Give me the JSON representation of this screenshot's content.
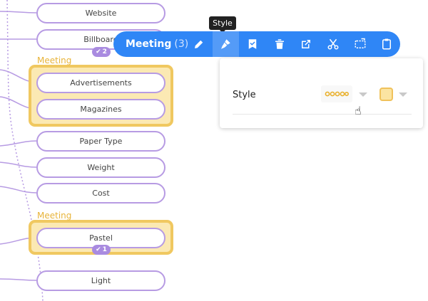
{
  "nodes": [
    {
      "label": "Website"
    },
    {
      "label": "Billboard"
    },
    {
      "label": "Advertisements"
    },
    {
      "label": "Magazines"
    },
    {
      "label": "Paper Type"
    },
    {
      "label": "Weight"
    },
    {
      "label": "Cost"
    },
    {
      "label": "Pastel"
    },
    {
      "label": "Light"
    }
  ],
  "groups": [
    {
      "label": "Meeting"
    },
    {
      "label": "Meeting"
    }
  ],
  "badges": [
    {
      "icon": "check-icon",
      "count": "2"
    },
    {
      "icon": "check-icon",
      "count": "1"
    }
  ],
  "toolbar": {
    "title": "Meeting",
    "count": "(3)",
    "tooltip": "Style",
    "buttons": [
      "pencil-icon",
      "brush-icon",
      "bookmark-check-icon",
      "trash-icon",
      "external-link-icon",
      "scissors-icon",
      "dashed-box-icon",
      "clipboard-icon"
    ]
  },
  "panel": {
    "label": "Style",
    "swatch_color": "#fbe4a2",
    "border_color": "#f0c25b"
  },
  "colors": {
    "accent": "#2f86f6",
    "node_border": "#b79be3",
    "group_fill": "#fbe9b3",
    "group_border": "#f0c860",
    "group_label": "#e8b43a"
  }
}
